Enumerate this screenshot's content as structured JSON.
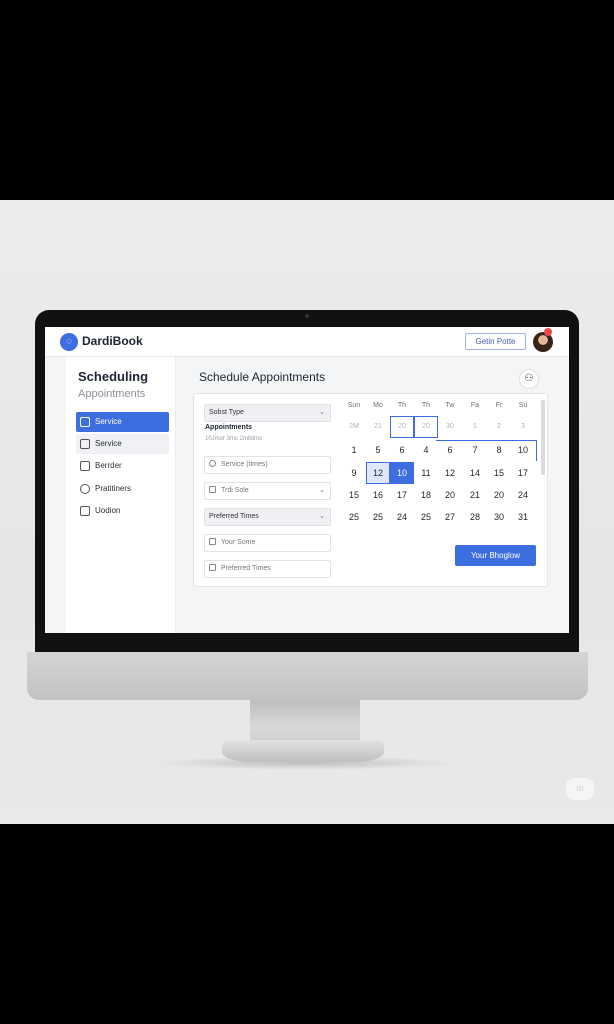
{
  "app": {
    "name": "DardiBook",
    "top_button": "Getin Potte"
  },
  "sidebar": {
    "title": "Scheduling",
    "subtitle": "Appointments",
    "items": [
      {
        "label": "Service",
        "icon": "lock-icon",
        "state": "active"
      },
      {
        "label": "Service",
        "icon": "check-icon",
        "state": "highlight"
      },
      {
        "label": "Berrder",
        "icon": "grid-icon",
        "state": "normal"
      },
      {
        "label": "Pratitiners",
        "icon": "smile-icon",
        "state": "normal"
      },
      {
        "label": "Uodion",
        "icon": "check-icon",
        "state": "normal"
      }
    ]
  },
  "main": {
    "title": "Schedule Appointments",
    "form": {
      "select_type": "Sobst Type",
      "appointments_label": "Appointments",
      "appointments_sub": "10Jmor 3mc 2mlldms",
      "service_times": "Service (times)",
      "trdi_sole": "Trdi Sole",
      "preferred_times_select": "Preferred Times",
      "your_some": "Your Some",
      "preferred_times_field": "Preferred Times"
    },
    "calendar": {
      "weekdays": [
        "Sun",
        "Mo",
        "Th",
        "Th",
        "Tw",
        "Fa",
        "Fr",
        "Su"
      ],
      "rows": [
        [
          "2M",
          "21",
          "20",
          "20",
          "30",
          "1",
          "2",
          "3"
        ],
        [
          "1",
          "5",
          "6",
          "4",
          "6",
          "7",
          "8",
          "10"
        ],
        [
          "9",
          "12",
          "10",
          "11",
          "12",
          "14",
          "15",
          "17"
        ],
        [
          "15",
          "16",
          "17",
          "18",
          "20",
          "21",
          "20",
          "24"
        ],
        [
          "25",
          "25",
          "24",
          "25",
          "27",
          "28",
          "30",
          "31"
        ]
      ]
    },
    "cta": "Your Bhoglow"
  },
  "accent_color": "#3d6ee0",
  "watermark": "ai"
}
